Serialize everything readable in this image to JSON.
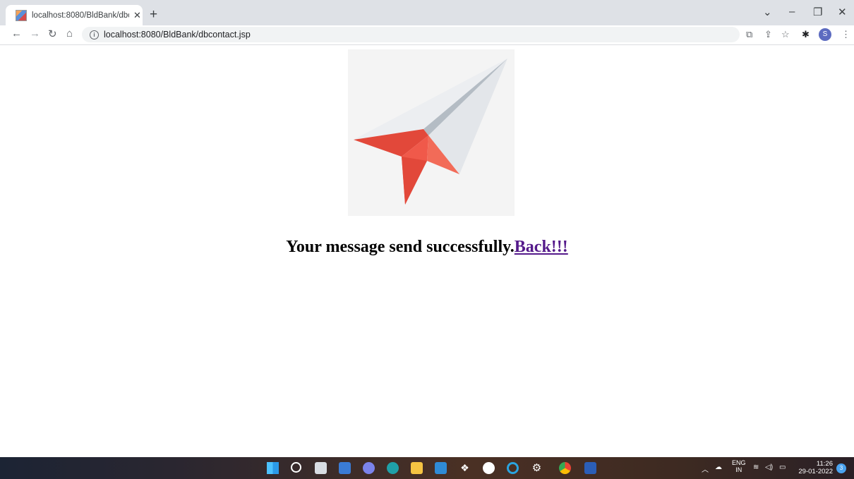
{
  "browser": {
    "tab_title": "localhost:8080/BldBank/dbconta",
    "tab_close": "✕",
    "new_tab": "+",
    "url": "localhost:8080/BldBank/dbcontact.jsp",
    "profile_initial": "S",
    "window_controls": [
      "⌄",
      "–",
      "❐",
      "✕"
    ]
  },
  "page": {
    "message": "Your message send successfully.",
    "back_link": "Back!!!"
  },
  "taskbar": {
    "language_top": "ENG",
    "language_bottom": "IN",
    "time": "11:26",
    "date": "29-01-2022",
    "notification_count": "3"
  },
  "colors": {
    "link": "#551a8b",
    "plane_red": "#f0594a",
    "plane_white": "#e3e6ea"
  }
}
